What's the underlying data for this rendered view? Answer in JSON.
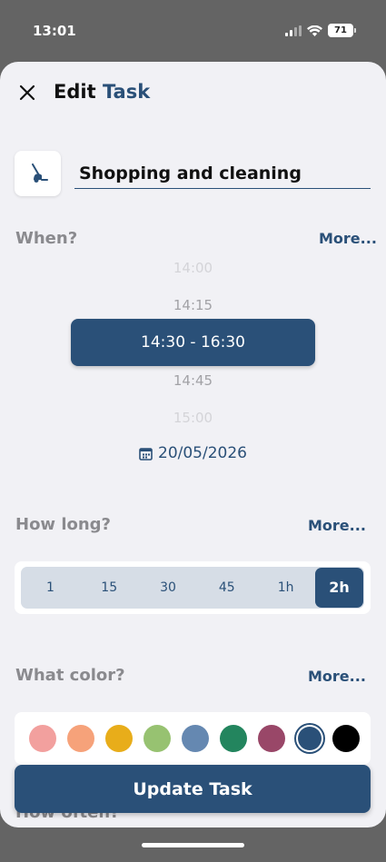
{
  "status_bar": {
    "time": "13:01",
    "battery": "71"
  },
  "header": {
    "title_prefix": "Edit",
    "title_accent": "Task"
  },
  "task": {
    "name": "Shopping and cleaning",
    "icon": "vacuum-cleaner-icon"
  },
  "when": {
    "label": "When?",
    "more": "More...",
    "times": [
      "14:00",
      "14:15",
      "14:45",
      "15:00"
    ],
    "selected_range": "14:30 - 16:30",
    "date": "20/05/2026"
  },
  "how_long": {
    "label": "How long?",
    "more": "More...",
    "options": [
      "1",
      "15",
      "30",
      "45",
      "1h",
      "2h"
    ],
    "selected": "2h"
  },
  "color": {
    "label": "What color?",
    "more": "More...",
    "swatches": [
      "#f2a09e",
      "#f6a27a",
      "#e8ad1a",
      "#97c271",
      "#6588b1",
      "#23855e",
      "#994768",
      "#2a5078",
      "#000000"
    ],
    "selected_index": 7
  },
  "how_often": {
    "label": "How often?"
  },
  "update_button": "Update Task",
  "colors": {
    "accent": "#2a5078",
    "background": "#f1f1f5"
  }
}
